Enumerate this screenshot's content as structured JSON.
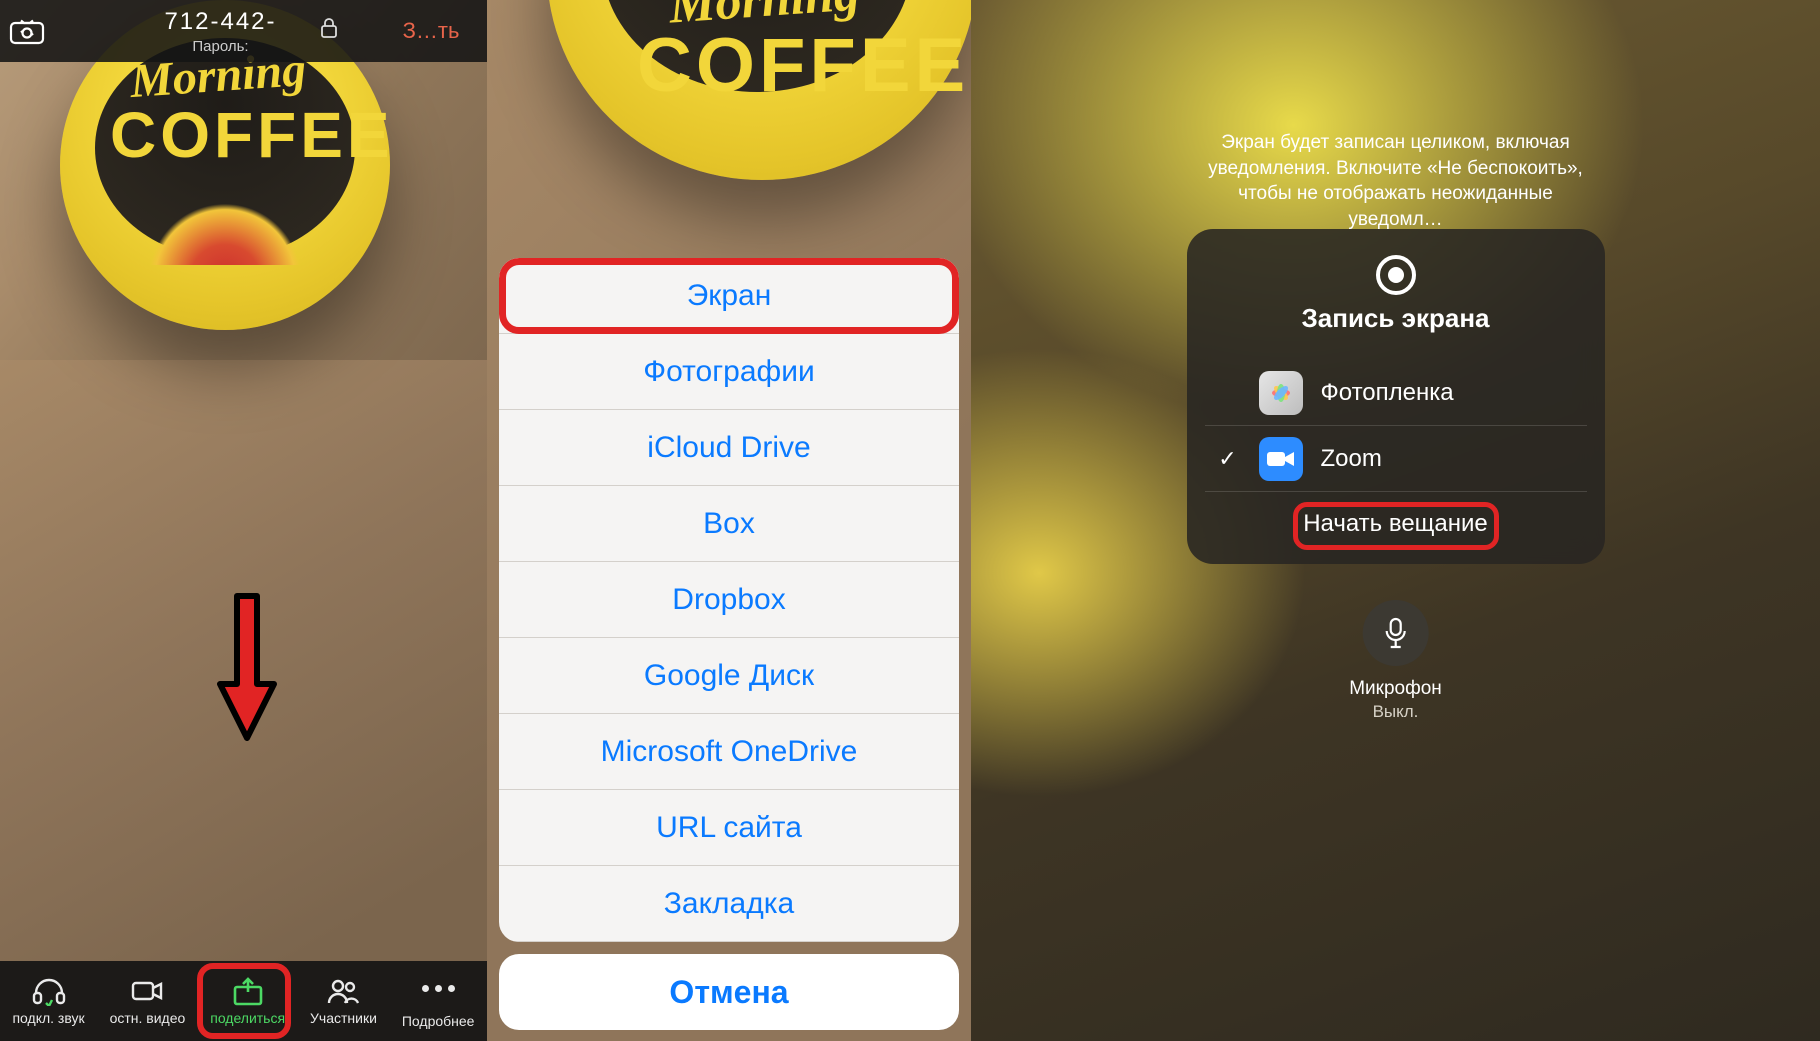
{
  "left": {
    "meeting_id": "712-442-",
    "password_label": "Пароль:",
    "end_label": "З…ть",
    "mug": {
      "line1": "Morning",
      "line2": "COFFEE"
    },
    "bottom": {
      "audio": "подкл. звук",
      "video": "остн. видео",
      "share": "поделиться",
      "participants": "Участники",
      "more": "Подробнее"
    }
  },
  "middle": {
    "mug": {
      "line1": "Morning",
      "line2": "COFFEE"
    },
    "share_options": [
      "Экран",
      "Фотографии",
      "iCloud Drive",
      "Box",
      "Dropbox",
      "Google Диск",
      "Microsoft OneDrive",
      "URL сайта",
      "Закладка"
    ],
    "cancel": "Отмена"
  },
  "right": {
    "notice": "Экран будет записан целиком, включая уведомления. Включите «Не беспокоить», чтобы не отображать неожиданные уведомл…",
    "title": "Запись экрана",
    "dest_photos": "Фотопленка",
    "dest_zoom": "Zoom",
    "start": "Начать вещание",
    "mic_label": "Микрофон",
    "mic_state": "Выкл."
  }
}
